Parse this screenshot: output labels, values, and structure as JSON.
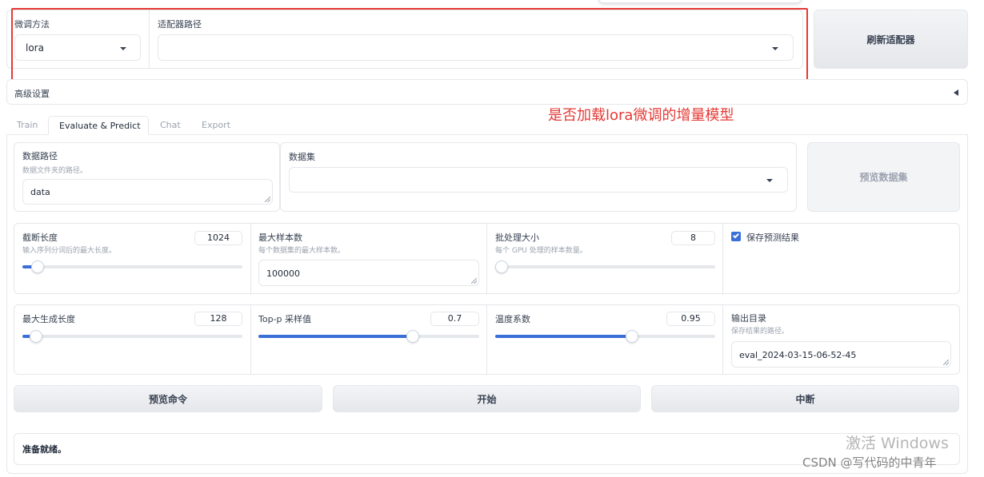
{
  "top": {
    "finetune_method": {
      "label": "微调方法",
      "value": "lora"
    },
    "adapter_path": {
      "label": "适配器路径",
      "value": ""
    },
    "refresh_button": "刷新适配器"
  },
  "advanced": {
    "label": "高级设置",
    "toggle_icon": "triangle-left-icon"
  },
  "annotation": {
    "text": "是否加载lora微调的增量模型",
    "color": "#e53935"
  },
  "tabs": [
    "Train",
    "Evaluate & Predict",
    "Chat",
    "Export"
  ],
  "active_tab": "Evaluate & Predict",
  "data": {
    "dataset_dir": {
      "label": "数据路径",
      "hint": "数据文件夹的路径。",
      "value": "data"
    },
    "dataset": {
      "label": "数据集",
      "value": ""
    },
    "preview_button": "预览数据集"
  },
  "params": {
    "cutoff_len": {
      "label": "截断长度",
      "hint": "输入序列分词后的最大长度。",
      "value": "1024",
      "level": 0.07
    },
    "max_samples": {
      "label": "最大样本数",
      "hint": "每个数据集的最大样本数。",
      "value": "100000"
    },
    "batch_size": {
      "label": "批处理大小",
      "hint": "每个 GPU 处理的样本数量。",
      "value": "8",
      "level": 0.03
    },
    "predict": {
      "label": "保存预测结果",
      "checked": true
    }
  },
  "gen": {
    "max_new_tokens": {
      "label": "最大生成长度",
      "value": "128",
      "level": 0.06
    },
    "top_p": {
      "label": "Top-p 采样值",
      "value": "0.7",
      "level": 0.7
    },
    "temperature": {
      "label": "温度系数",
      "value": "0.95",
      "level": 0.62
    },
    "output_dir": {
      "label": "输出目录",
      "hint": "保存结果的路径。",
      "value": "eval_2024-03-15-06-52-45"
    }
  },
  "actions": {
    "preview_cmd": "预览命令",
    "start": "开始",
    "abort": "中断"
  },
  "status": "准备就绪。",
  "watermark": {
    "activate": "激活 Windows",
    "csdn": "CSDN @写代码的中青年"
  },
  "colors": {
    "accent": "#3b6fd8",
    "annotation": "#e53935"
  }
}
